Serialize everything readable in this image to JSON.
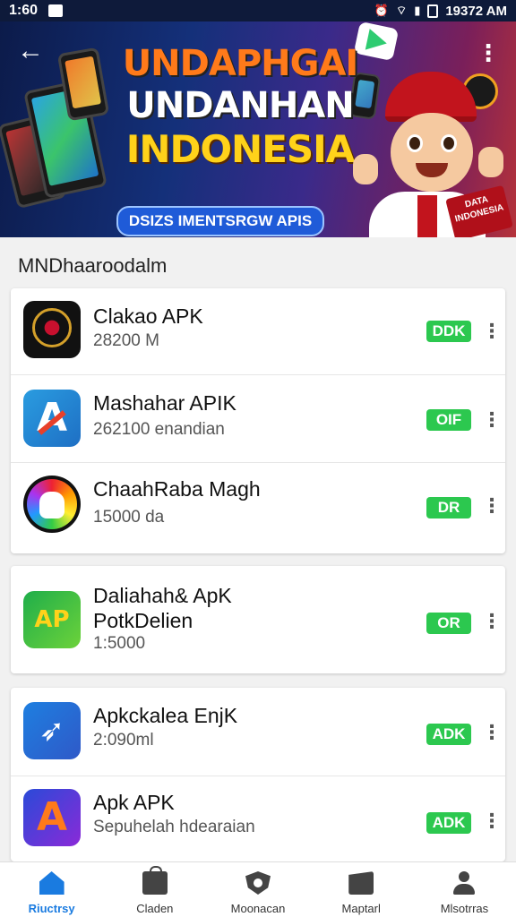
{
  "status_bar": {
    "time": "1:60",
    "right_text": "19372 AM"
  },
  "banner": {
    "title_line1": "UNDAPHGAI",
    "title_line2": "UNDANHAN",
    "title_line3": "INDONESIA",
    "subtitle": "DSIZS IMENTSRGW APIS",
    "corner_badge": "DATA INDONESIA"
  },
  "section_title": "MNDhaaroodalm",
  "apps": [
    {
      "title": "Clakao APK",
      "subtitle": "28200 M",
      "button": "DDK",
      "icon": "seal-emblem-icon"
    },
    {
      "title": "Mashahar APIK",
      "subtitle": "262100 enandian",
      "button": "OIF",
      "icon": "a-letter-icon"
    },
    {
      "title": "ChaahRaba Magh",
      "subtitle": "15000 da",
      "button": "DR",
      "icon": "rainbow-skull-icon"
    },
    {
      "title_line1": "Daliahah& ApK",
      "title_line2": "PotkDelien",
      "subtitle": "1:5000",
      "button": "OR",
      "icon": "green-badge-icon"
    },
    {
      "title": "Apkckalea EnjK",
      "subtitle": "2:090ml",
      "button": "ADK",
      "icon": "paper-plane-icon"
    },
    {
      "title": "Apk APK",
      "subtitle": "Sepuhelah hdearaian",
      "button": "ADK",
      "icon": "a-letter-icon"
    }
  ],
  "bottom_nav": [
    {
      "label": "Riuctrsy",
      "icon": "home-icon",
      "active": true
    },
    {
      "label": "Claden",
      "icon": "shopping-bag-icon",
      "active": false
    },
    {
      "label": "Moonacan",
      "icon": "shield-icon",
      "active": false
    },
    {
      "label": "Maptarl",
      "icon": "mail-icon",
      "active": false
    },
    {
      "label": "Mlsotrras",
      "icon": "user-icon",
      "active": false
    }
  ],
  "colors": {
    "accent": "#1a7be0",
    "install_button": "#2cc84f",
    "banner_dark": "#0c1b4a"
  }
}
